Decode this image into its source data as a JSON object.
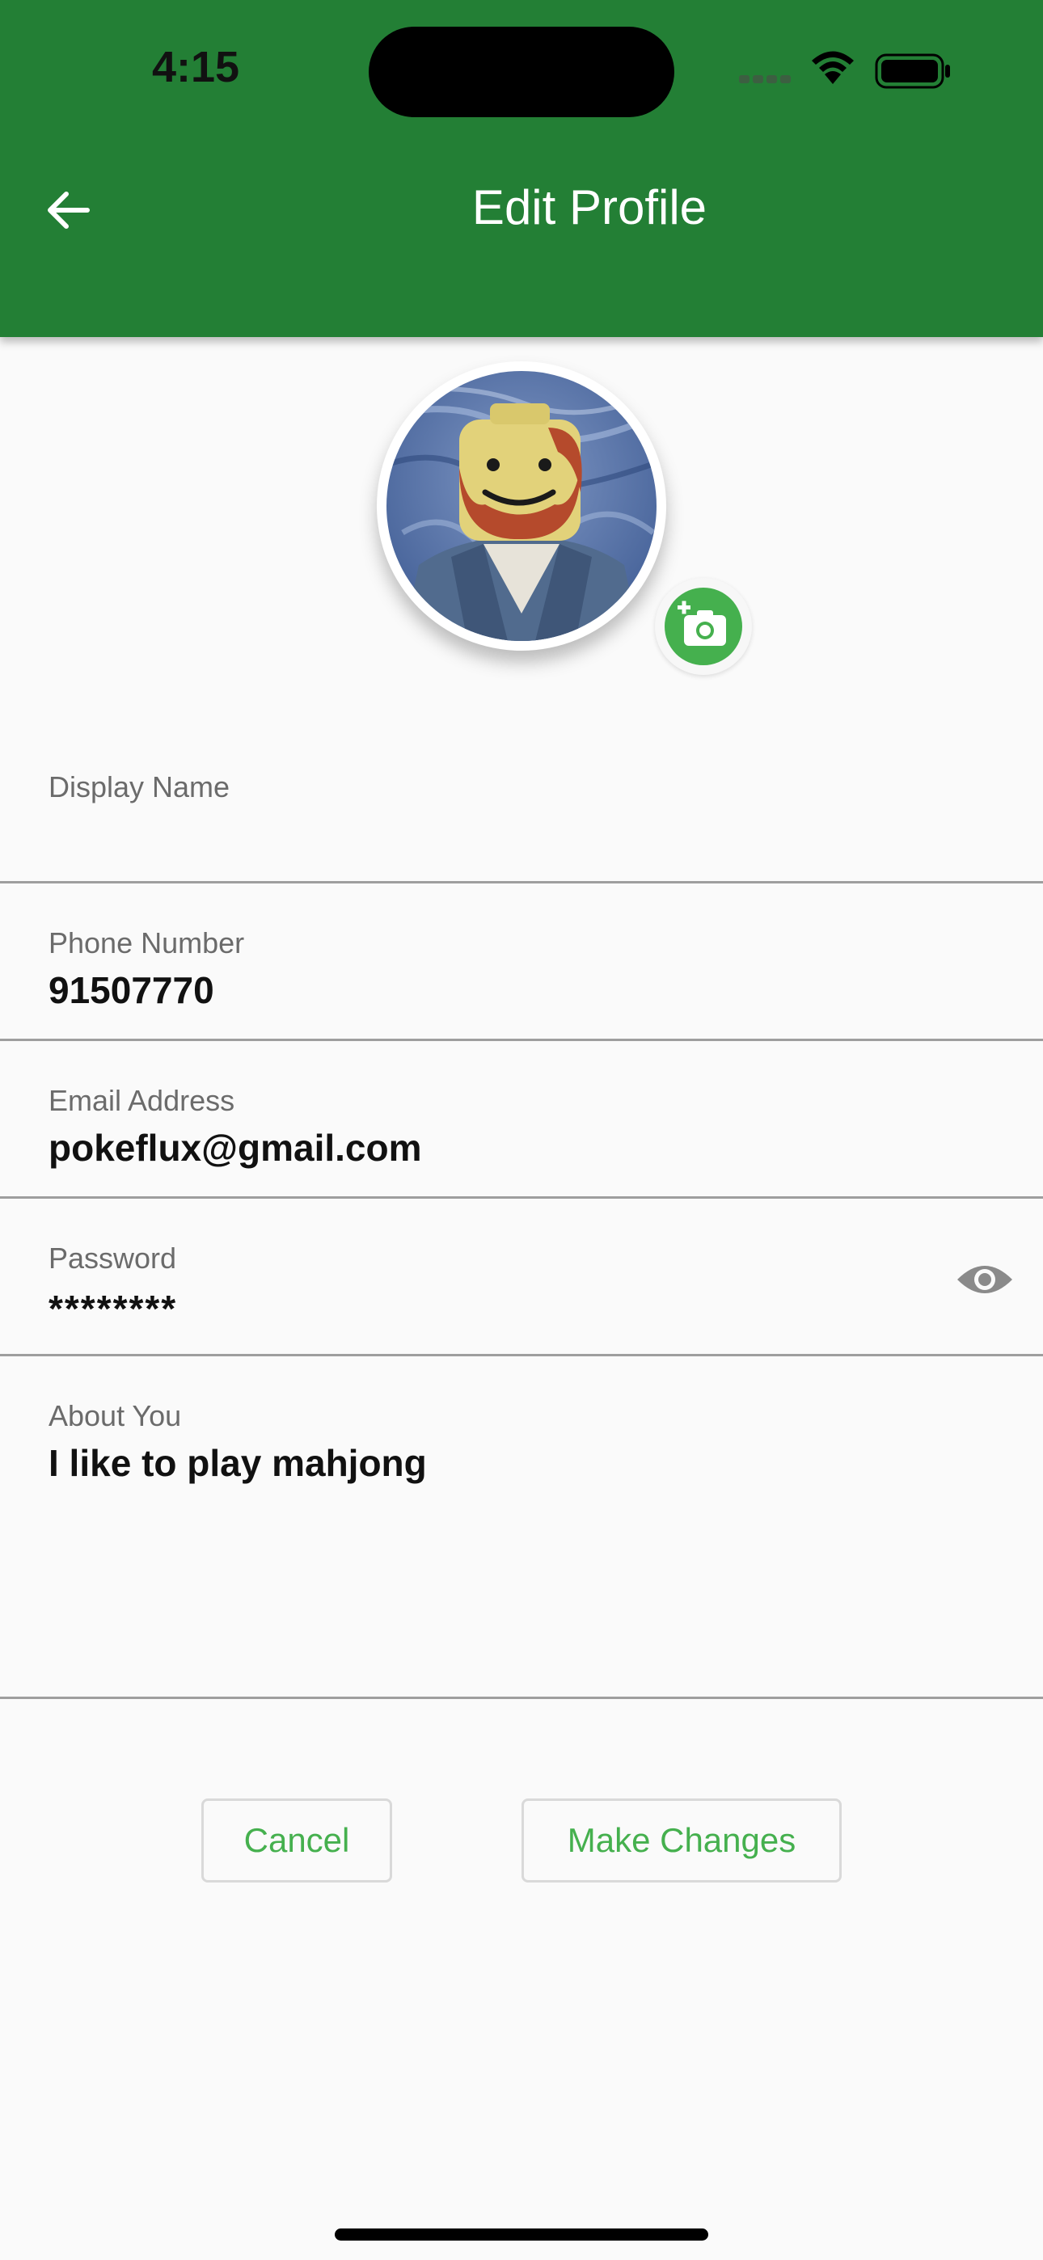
{
  "status_bar": {
    "time": "4:15"
  },
  "app_bar": {
    "title": "Edit Profile",
    "back_icon": "arrow-left-icon"
  },
  "profile": {
    "avatar_icon": "avatar-image",
    "change_photo_icon": "add-photo-camera-icon"
  },
  "form": {
    "display_name": {
      "label": "Display Name",
      "value": ""
    },
    "phone_number": {
      "label": "Phone Number",
      "value": "91507770"
    },
    "email": {
      "label": "Email Address",
      "value": "pokeflux@gmail.com"
    },
    "password": {
      "label": "Password",
      "value": "********",
      "toggle_icon": "eye-icon"
    },
    "about": {
      "label": "About You",
      "value": "I like to play mahjong"
    }
  },
  "actions": {
    "cancel_label": "Cancel",
    "submit_label": "Make Changes"
  },
  "colors": {
    "app_bar": "#237f35",
    "accent": "#45b04e",
    "background": "#fafafa",
    "divider": "#9e9e9e",
    "label": "#6b6b6b"
  }
}
